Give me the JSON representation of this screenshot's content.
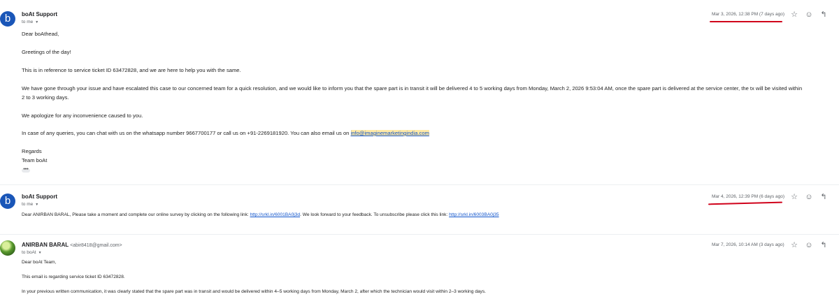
{
  "messages": [
    {
      "avatar_letter": "b",
      "sender": "boAt Support",
      "sender_email": "",
      "to": "to me",
      "date": "Mar 3, 2026, 12:38 PM (7 days ago)",
      "body": [
        "Dear boAthead,",
        "Greetings of the day!",
        "This is in reference to service ticket ID 63472828, and we are here to help you with the same.",
        "We have gone through your issue and have escalated this case to our concerned team for a quick resolution, and we would like to inform you that the spare part is in transit it will be delivered 4 to 5 working days from Monday, March 2, 2026 9:53:04 AM, once the spare part is delivered at the service center, the tx will be visited within",
        "2 to 3 working days.",
        "We apologize for any inconvenience caused to you.",
        "In case of any queries, you can chat with us on the whatsapp number 9667700177 or call us on +91-2269181920. You can also email us on ",
        "Regards",
        "Team boAt"
      ],
      "email_link": "info@imaginemarketingindia.com"
    },
    {
      "avatar_letter": "b",
      "sender": "boAt Support",
      "sender_email": "",
      "to": "to me",
      "date": "Mar 4, 2026, 12:39 PM (6 days ago)",
      "body_prefix": "Dear ANIRBAN BARAL, Please take a moment and complete our online survey by clicking on the following link: ",
      "survey_link": "http://srkl.in/6001BA0j3d",
      "body_middle": ". We look forward to your feedback. To unsubscribe please click this link: ",
      "unsubscribe_link": "http://srkl.in/6003BA0j35"
    },
    {
      "avatar_letter": "",
      "sender": "ANIRBAN BARAL",
      "sender_email": "<abir8418@gmail.com>",
      "to": "to boAt",
      "date": "Mar 7, 2026, 10:14 AM (3 days ago)",
      "body": [
        "Dear boAt Team,",
        "This email is regarding service ticket ID 63472828.",
        "In your previous written communication, it was clearly stated that the spare part was in transit and would be delivered within 4–5 working days from Monday, March 2, after which the technician would visit within 2–3 working days."
      ]
    }
  ],
  "icons": {
    "star": "☆",
    "emoji": "☺",
    "reply": "↰",
    "more": "•••"
  },
  "accent_colors": {
    "avatar": "#1a56b8",
    "annotation": "#d0021b",
    "link": "#1155cc"
  }
}
